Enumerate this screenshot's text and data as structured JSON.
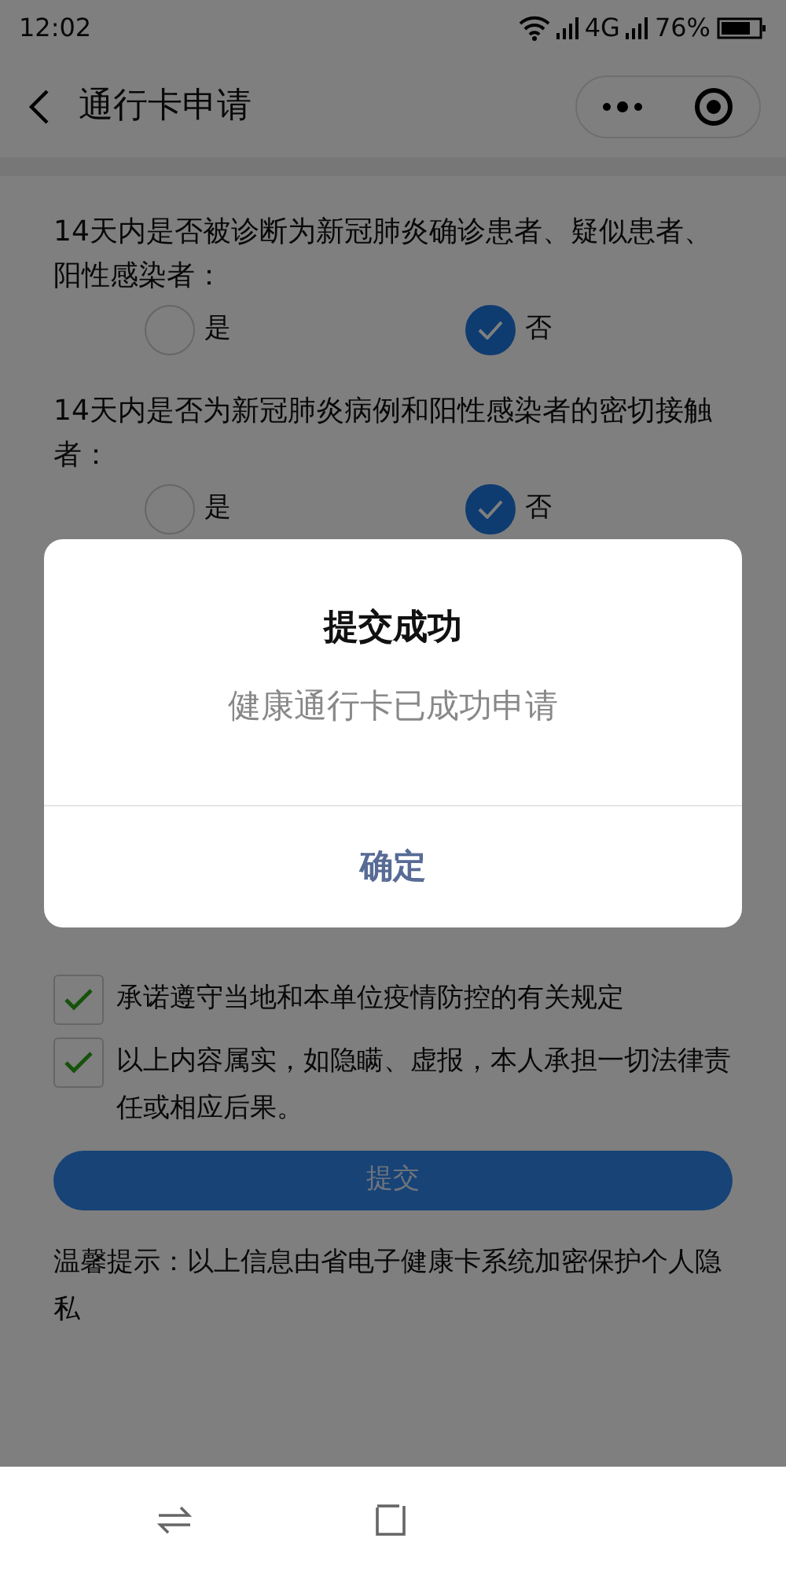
{
  "status_bar": {
    "time": "12:02",
    "network": "4G",
    "battery": "76%"
  },
  "nav_bar": {
    "title": "通行卡申请"
  },
  "questions": [
    {
      "text": "14天内是否被诊断为新冠肺炎确诊患者、疑似患者、阳性感染者：",
      "options": [
        {
          "label": "是",
          "selected": false
        },
        {
          "label": "否",
          "selected": true
        }
      ]
    },
    {
      "text": "14天内是否为新冠肺炎病例和阳性感染者的密切接触者：",
      "options": [
        {
          "label": "是",
          "selected": false
        },
        {
          "label": "否",
          "selected": true
        }
      ]
    }
  ],
  "pledges": [
    {
      "label": "承诺遵守当地和本单位疫情防控的有关规定",
      "checked": true
    },
    {
      "label": "以上内容属实，如隐瞒、虚报，本人承担一切法律责任或相应后果。",
      "checked": true
    }
  ],
  "submit_button": {
    "label": "提交"
  },
  "tip": "温馨提示：以上信息由省电子健康卡系统加密保护个人隐私",
  "dialog": {
    "title": "提交成功",
    "message": "健康通行卡已成功申请",
    "confirm": "确定"
  }
}
